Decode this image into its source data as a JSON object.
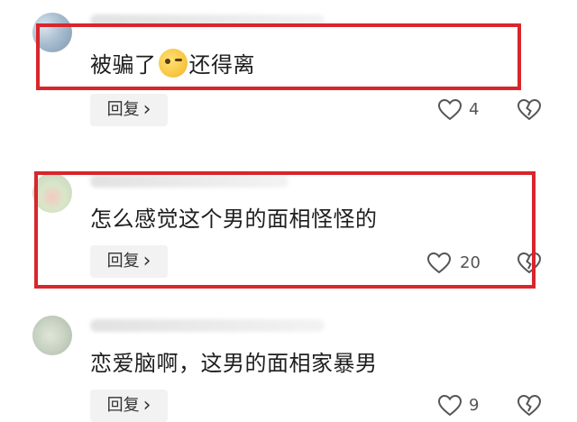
{
  "comments": [
    {
      "text_before": "被骗了",
      "text_after": "还得离",
      "emoji": "thinking-face-emoji",
      "reply_label": "回复",
      "reply_chevron": "›",
      "like_count": "4",
      "highlighted": true
    },
    {
      "text": "怎么感觉这个男的面相怪怪的",
      "reply_label": "回复",
      "reply_chevron": "›",
      "like_count": "20",
      "highlighted": true
    },
    {
      "text": "恋爱脑啊，这男的面相家暴男",
      "reply_label": "回复",
      "reply_chevron": "›",
      "like_count": "9",
      "highlighted": false
    }
  ],
  "colors": {
    "highlight_border": "#d8262c",
    "reply_bg": "#f2f2f2",
    "text": "#1e1e1e"
  },
  "icons": {
    "like": "heart-outline-icon",
    "dislike": "broken-heart-icon",
    "chevron": "chevron-right-icon"
  }
}
